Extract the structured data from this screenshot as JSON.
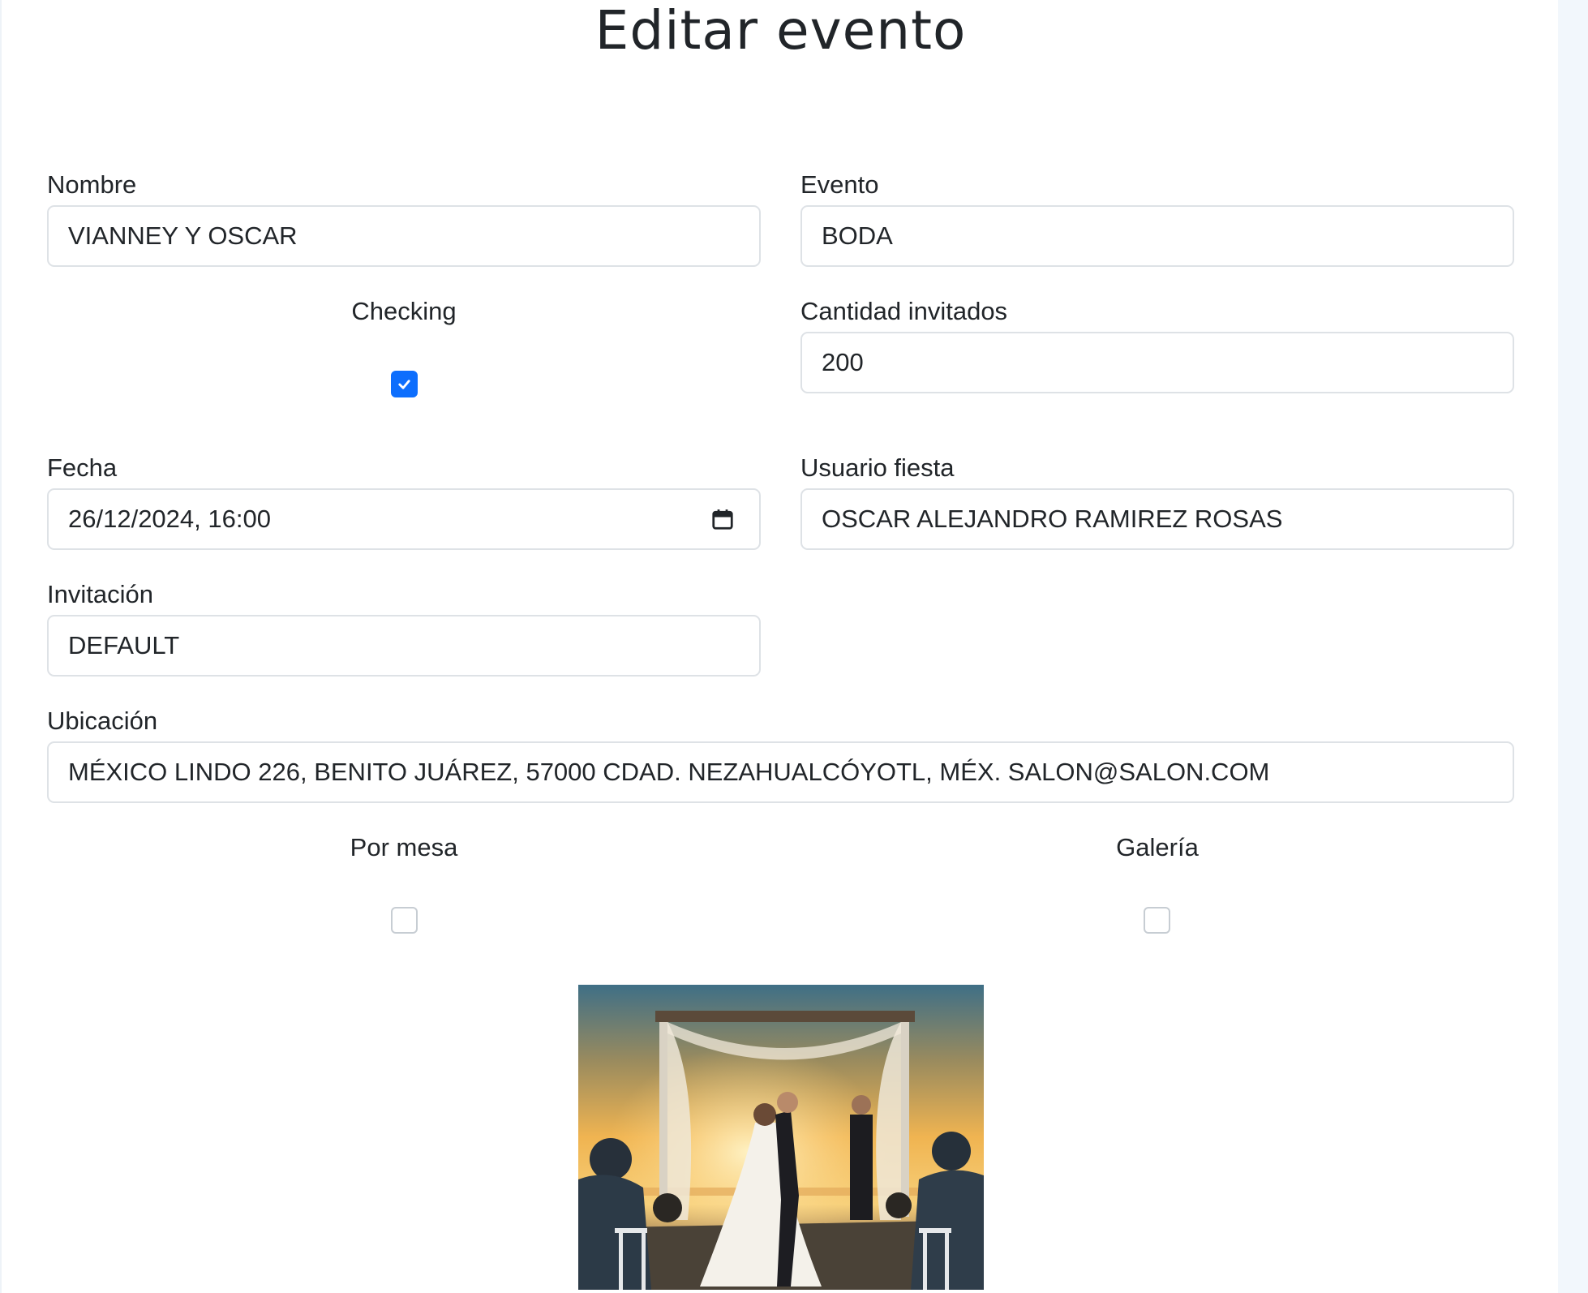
{
  "page": {
    "title": "Editar evento"
  },
  "form": {
    "nombre": {
      "label": "Nombre",
      "value": "VIANNEY Y OSCAR"
    },
    "evento": {
      "label": "Evento",
      "value": "BODA"
    },
    "checking": {
      "label": "Checking",
      "checked": true
    },
    "cantidad_invitados": {
      "label": "Cantidad invitados",
      "value": "200"
    },
    "fecha": {
      "label": "Fecha",
      "value": "26/12/2024, 16:00",
      "icon": "calendar-icon"
    },
    "usuario_fiesta": {
      "label": "Usuario fiesta",
      "value": "OSCAR ALEJANDRO RAMIREZ ROSAS"
    },
    "invitacion": {
      "label": "Invitación",
      "value": "DEFAULT"
    },
    "ubicacion": {
      "label": "Ubicación",
      "value": "MÉXICO LINDO 226, BENITO JUÁREZ, 57000 CDAD. NEZAHUALCÓYOTL, MÉX. SALON@SALON.COM"
    },
    "por_mesa": {
      "label": "Por mesa",
      "checked": false
    },
    "galeria": {
      "label": "Galería",
      "checked": false
    }
  },
  "image": {
    "subject": "wedding-couple-sunset-photo"
  },
  "colors": {
    "accent": "#0d6efd",
    "border": "#dee2e6",
    "text": "#212529"
  }
}
